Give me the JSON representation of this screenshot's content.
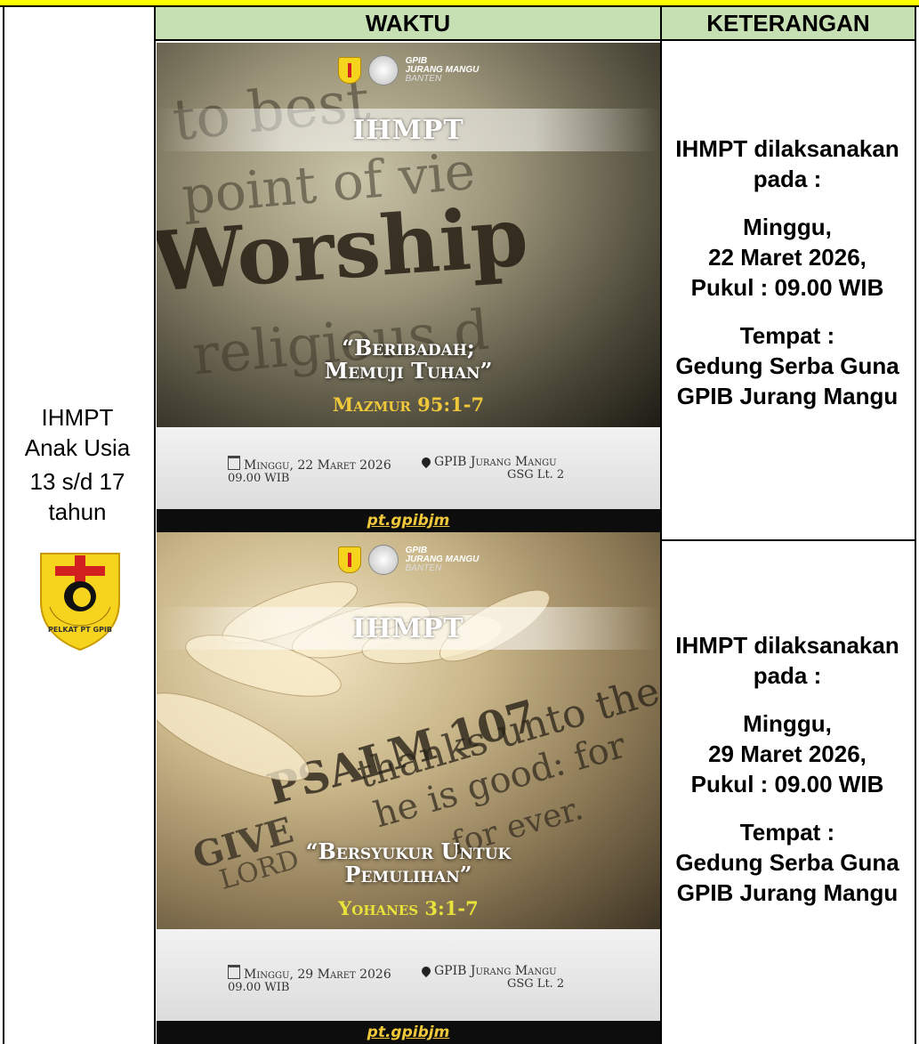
{
  "header": {
    "col_time": "WAKTU",
    "col_desc": "KETERANGAN"
  },
  "category": {
    "line1": "IHMPT",
    "line2": "Anak Usia",
    "line3": "13 s/d 17",
    "line4": "tahun",
    "emblem_text": "PELKAT PT GPIB"
  },
  "rows": [
    {
      "poster": {
        "org_line1": "GPIB",
        "org_line2": "JURANG MANGU",
        "org_line3": "BANTEN",
        "banner": "IHMPT",
        "bg_words": [
          "to best",
          "point of vie",
          "Worship",
          "religious d"
        ],
        "theme_line1": "“Beribadah;",
        "theme_line2": "Memuji Tuhan”",
        "verse": "Mazmur 95:1-7",
        "date": "Minggu, 22 Maret 2026",
        "time": "09.00 WIB",
        "place": "GPIB Jurang Mangu",
        "room": "GSG Lt. 2",
        "footer": "pt.gpibjm"
      },
      "desc": {
        "l1": "IHMPT dilaksanakan",
        "l2": "pada :",
        "l3": "Minggu,",
        "l4": "22 Maret 2026,",
        "l5": "Pukul : 09.00 WIB",
        "l6": "Tempat :",
        "l7": "Gedung Serba Guna",
        "l8": "GPIB Jurang Mangu"
      }
    },
    {
      "poster": {
        "org_line1": "GPIB",
        "org_line2": "JURANG MANGU",
        "org_line3": "BANTEN",
        "banner": "IHMPT",
        "bg_words": [
          "PSALM 107",
          "thanks unto the",
          "he is good: for",
          "for ever.",
          "GIVE",
          "LORD"
        ],
        "theme_line1": "“Bersyukur Untuk",
        "theme_line2": "Pemulihan”",
        "verse": "Yohanes 3:1-7",
        "date": "Minggu, 29 Maret 2026",
        "time": "09.00 WIB",
        "place": "GPIB Jurang Mangu",
        "room": "GSG Lt. 2",
        "footer": "pt.gpibjm"
      },
      "desc": {
        "l1": "IHMPT dilaksanakan",
        "l2": "pada :",
        "l3": "Minggu,",
        "l4": "29 Maret 2026,",
        "l5": "Pukul : 09.00 WIB",
        "l6": "Tempat :",
        "l7": "Gedung Serba Guna",
        "l8": "GPIB Jurang Mangu"
      }
    }
  ],
  "colors": {
    "header_bg": "#c6e0b4",
    "top_band": "#ffff00",
    "verse1": "#f0c93a",
    "verse2": "#e8e23a",
    "footer_link": "#f0c93a"
  }
}
